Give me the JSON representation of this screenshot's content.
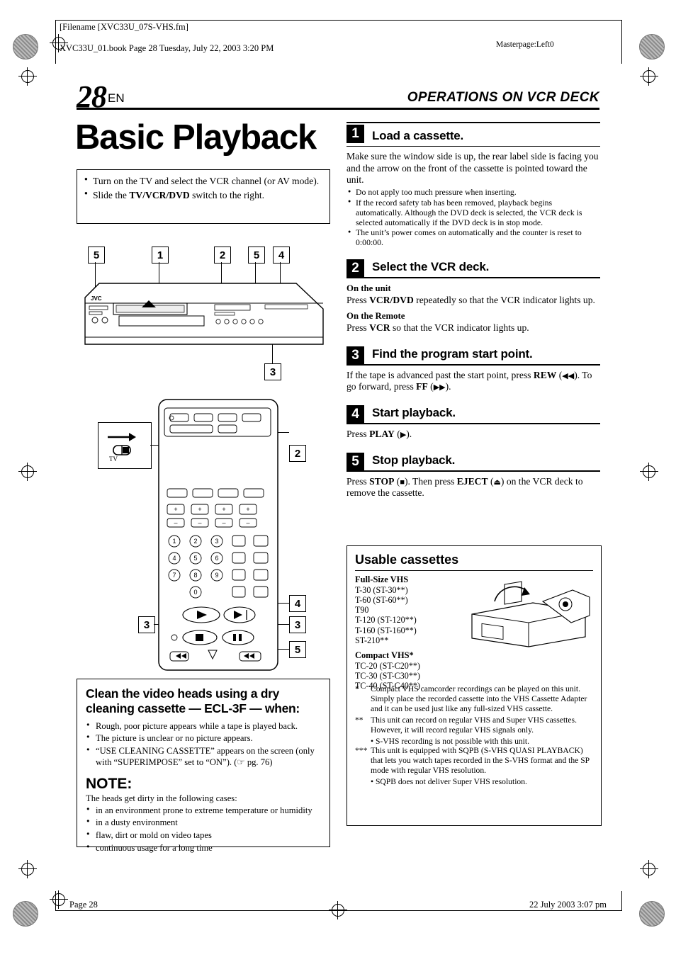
{
  "header": {
    "filename": "[Filename [XVC33U_07S-VHS.fm]",
    "bookline": "XVC33U_01.book  Page 28  Tuesday, July 22, 2003  3:20 PM",
    "masterpage": "Masterpage:Left0"
  },
  "page": {
    "number": "28",
    "lang": "EN",
    "section": "OPERATIONS ON VCR DECK",
    "title": "Basic Playback"
  },
  "intro": {
    "items": [
      "Turn on the TV and select the VCR channel (or AV mode).",
      "Slide the TV/VCR/DVD switch to the right."
    ],
    "bold_terms": [
      "TV/VCR/DVD"
    ]
  },
  "callouts": {
    "deck": [
      "5",
      "1",
      "2",
      "5",
      "4",
      "3"
    ],
    "remote": [
      "2",
      "4",
      "3",
      "3",
      "5"
    ]
  },
  "steps": [
    {
      "num": "1",
      "title": "Load a cassette.",
      "body": "Make sure the window side is up, the rear label side is facing you and the arrow on the front of the cassette is pointed toward the unit.",
      "bullets": [
        "Do not apply too much pressure when inserting.",
        "If the record safety tab has been removed, playback begins automatically. Although the DVD deck is selected, the VCR deck is selected automatically if the DVD deck is in stop mode.",
        "The unit’s power comes on automatically and the counter is reset to 0:00:00."
      ]
    },
    {
      "num": "2",
      "title": "Select the VCR deck.",
      "sub1_head": "On the unit",
      "sub1_body": "Press VCR/DVD repeatedly so that the VCR indicator lights up.",
      "sub2_head": "On the Remote",
      "sub2_body": "Press VCR so that the VCR indicator lights up."
    },
    {
      "num": "3",
      "title": "Find the program start point.",
      "body": "If the tape is advanced past the start point, press REW (◀◀). To go forward, press FF (▶▶)."
    },
    {
      "num": "4",
      "title": "Start playback.",
      "body": "Press PLAY (▶)."
    },
    {
      "num": "5",
      "title": "Stop playback.",
      "body": "Press STOP (■). Then press EJECT (⏏) on the VCR deck to remove the cassette."
    }
  ],
  "clean_box": {
    "heading": "Clean the video heads using a dry cleaning cassette — ECL-3F — when:",
    "bullets": [
      "Rough, poor picture appears while a tape is played back.",
      "The picture is unclear or no picture appears.",
      "“USE CLEANING CASSETTE” appears on the screen (only with “SUPERIMPOSE” set to “ON”). (☞ pg. 76)"
    ],
    "note_title": "NOTE:",
    "note_intro": "The heads get dirty in the following cases:",
    "note_items": [
      "in an environment prone to extreme temperature or humidity",
      "in a dusty environment",
      "flaw, dirt or mold on video tapes",
      "continuous usage for a long time"
    ]
  },
  "usable": {
    "title": "Usable cassettes",
    "group1_head": "Full-Size VHS",
    "group1_items": [
      "T-30 (ST-30**)",
      "T-60 (ST-60**)",
      "T90",
      "T-120 (ST-120**)",
      "T-160 (ST-160**)",
      "ST-210**"
    ],
    "group2_head": "Compact VHS*",
    "group2_items": [
      "TC-20 (ST-C20**)",
      "TC-30 (ST-C30**)",
      "TC-40 (ST-C40**)"
    ],
    "footnotes": [
      {
        "mark": "*",
        "text": "Compact VHS camcorder recordings can be played on this unit. Simply place the recorded cassette into the VHS Cassette Adapter and it can be used just like any full-sized VHS cassette."
      },
      {
        "mark": "**",
        "text": "This unit can record on regular VHS and Super VHS cassettes. However, it will record regular VHS signals only."
      },
      {
        "mark": "",
        "text": "• S-VHS recording is not possible with this unit.",
        "sub": true
      },
      {
        "mark": "***",
        "text": "This unit is equipped with SQPB (S-VHS QUASI PLAYBACK) that lets you watch tapes recorded in the S-VHS format and the SP mode with regular VHS resolution."
      },
      {
        "mark": "",
        "text": "• SQPB does not deliver Super VHS resolution.",
        "sub": true
      }
    ]
  },
  "footer": {
    "left": "Page 28",
    "right": "22 July 2003 3:07 pm"
  },
  "deck": {
    "brand": "JVC"
  },
  "tv_inset": {
    "label": "TV"
  }
}
